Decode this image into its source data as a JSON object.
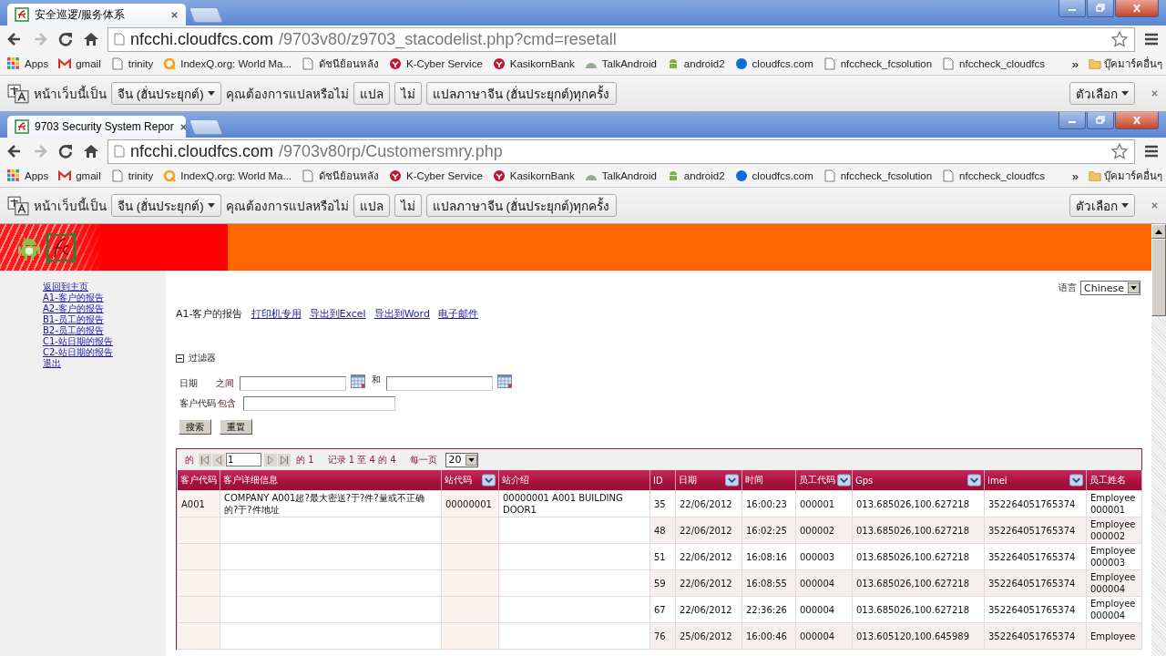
{
  "browser_windows": [
    {
      "tab_title": "安全巡逻/服务体系",
      "url_host": "nfcchi.cloudfcs.com",
      "url_path": "/9703v80/z9703_stacodelist.php?cmd=resetall",
      "bookmarks": [
        "Apps",
        "gmail",
        "trinity",
        "IndexQ.org: World Ma...",
        "ดัชนีย้อนหลัง",
        "K-Cyber Service",
        "KasikornBank",
        "TalkAndroid",
        "android2",
        "cloudfcs.com",
        "nfccheck_fcsolution",
        "nfccheck_cloudfcs"
      ],
      "bookmarks_overflow": "»",
      "other_bookmarks": "บุ๊คมาร์คอื่นๆ",
      "translate_bar": {
        "prefix": "หน้าเว็บนี้เป็น",
        "language": "จีน (ฮั่นประยุกต์)",
        "question": "คุณต้องการแปลหรือไม่",
        "translate_button": "แปล",
        "decline_button": "ไม่",
        "always_button": "แปลภาษาจีน (ฮั่นประยุกต์)ทุกครั้ง",
        "options_button": "ตัวเลือก"
      }
    },
    {
      "tab_title": "9703 Security System Repor",
      "url_host": "nfcchi.cloudfcs.com",
      "url_path": "/9703v80rp/Customersmry.php",
      "bookmarks": [
        "Apps",
        "gmail",
        "trinity",
        "IndexQ.org: World Ma...",
        "ดัชนีย้อนหลัง",
        "K-Cyber Service",
        "KasikornBank",
        "TalkAndroid",
        "android2",
        "cloudfcs.com",
        "nfccheck_fcsolution",
        "nfccheck_cloudfcs"
      ],
      "bookmarks_overflow": "»",
      "other_bookmarks": "บุ๊คมาร์คอื่นๆ",
      "translate_bar": {
        "prefix": "หน้าเว็บนี้เป็น",
        "language": "จีน (ฮั่นประยุกต์)",
        "question": "คุณต้องการแปลหรือไม่",
        "translate_button": "แปล",
        "decline_button": "ไม่",
        "always_button": "แปลภาษาจีน (ฮั่นประยุกต์)ทุกครั้ง",
        "options_button": "ตัวเลือก"
      }
    }
  ],
  "page": {
    "sidebar": {
      "links": [
        "返回到主页",
        "A1-客户的报告",
        "A2-客户的报告",
        "B1-员工的报告",
        "B2-员工的报告",
        "C1-站日期的报告",
        "C2-站日期的报告",
        "退出"
      ]
    },
    "language": {
      "label": "语言",
      "value": "Chinese"
    },
    "report": {
      "title": "A1-客户的报告",
      "links": [
        "打印机专用",
        "导出到Excel",
        "导出到Word",
        "电子邮件"
      ]
    },
    "filter": {
      "title": "过滤器",
      "expanded": true,
      "fields": [
        {
          "label": "日期",
          "operator": "之间",
          "kind": "date-range",
          "joiner": "和"
        },
        {
          "label": "客户代码",
          "operator": "包含",
          "kind": "text"
        }
      ],
      "buttons": [
        "搜索",
        "重置"
      ]
    },
    "pager": {
      "of_label": "的",
      "page": "1",
      "total_pages": "的 1",
      "records": "记录 1 至 4 的 4",
      "per_page_label": "每一页",
      "per_page": "20"
    },
    "table": {
      "columns": [
        {
          "label": "客户代码",
          "sortable": false
        },
        {
          "label": "客户详细信息",
          "sortable": false
        },
        {
          "label": "站代码",
          "sortable": true
        },
        {
          "label": "站介绍",
          "sortable": false
        },
        {
          "label": "ID",
          "sortable": false
        },
        {
          "label": "日期",
          "sortable": true
        },
        {
          "label": "时间",
          "sortable": false
        },
        {
          "label": "员工代码",
          "sortable": true
        },
        {
          "label": "Gps",
          "sortable": true
        },
        {
          "label": "Imei",
          "sortable": true
        },
        {
          "label": "员工姓名",
          "sortable": false
        }
      ],
      "rows": [
        {
          "customer_code": "A001",
          "customer_details": "COMPANY A001超?最大密送?于?件?量或不正确的?于?件地址",
          "station_code": "00000001",
          "station_description": "00000001 A001 BUILDING DOOR1",
          "id": "35",
          "date": "22/06/2012",
          "time": "16:00:23",
          "employee_code": "000001",
          "gps": "013.685026,100.627218",
          "imei": "352264051765374",
          "employee_name": "Employee 000001"
        },
        {
          "id": "48",
          "date": "22/06/2012",
          "time": "16:02:25",
          "employee_code": "000002",
          "gps": "013.685026,100.627218",
          "imei": "352264051765374",
          "employee_name": "Employee 000002"
        },
        {
          "id": "51",
          "date": "22/06/2012",
          "time": "16:08:16",
          "employee_code": "000003",
          "gps": "013.685026,100.627218",
          "imei": "352264051765374",
          "employee_name": "Employee 000003"
        },
        {
          "id": "59",
          "date": "22/06/2012",
          "time": "16:08:55",
          "employee_code": "000004",
          "gps": "013.685026,100.627218",
          "imei": "352264051765374",
          "employee_name": "Employee 000004"
        },
        {
          "id": "67",
          "date": "22/06/2012",
          "time": "22:36:26",
          "employee_code": "000004",
          "gps": "013.685026,100.627218",
          "imei": "352264051765374",
          "employee_name": "Employee 000004"
        },
        {
          "id": "76",
          "date": "25/06/2012",
          "time": "16:00:46",
          "employee_code": "000004",
          "gps": "013.605120,100.645989",
          "imei": "352264051765374",
          "employee_name": "Employee"
        }
      ]
    }
  }
}
